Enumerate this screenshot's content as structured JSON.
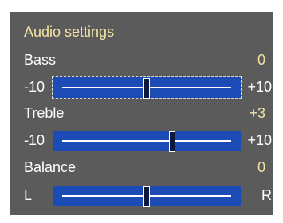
{
  "panel": {
    "title": "Audio settings",
    "controls": [
      {
        "label": "Bass",
        "value": "0",
        "min_label": "-10",
        "max_label": "+10",
        "level": 0.5,
        "focused": true
      },
      {
        "label": "Treble",
        "value": "+3",
        "min_label": "-10",
        "max_label": "+10",
        "level": 0.65,
        "focused": false
      },
      {
        "label": "Balance",
        "value": "0",
        "min_label": "L",
        "max_label": "R",
        "level": 0.5,
        "focused": false
      }
    ]
  },
  "colors": {
    "panel_bg": "#5b5b5b",
    "slider_bg": "#1d4bb6",
    "accent_text": "#f2e3a2",
    "text": "#ffffff"
  }
}
